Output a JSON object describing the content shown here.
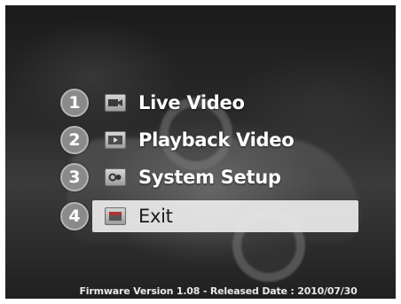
{
  "menu": {
    "items": [
      {
        "number": "1",
        "label": "Live Video",
        "icon": "live-video-icon",
        "selected": false
      },
      {
        "number": "2",
        "label": "Playback Video",
        "icon": "playback-video-icon",
        "selected": false
      },
      {
        "number": "3",
        "label": "System Setup",
        "icon": "system-setup-icon",
        "selected": false
      },
      {
        "number": "4",
        "label": "Exit",
        "icon": "exit-icon",
        "selected": true
      }
    ]
  },
  "footer": {
    "text": "Firmware Version 1.08 - Released Date : 2010/07/30"
  },
  "colors": {
    "selection_highlight": "#ebebeb",
    "text": "#ffffff",
    "number_badge": "#8a8a8a"
  }
}
